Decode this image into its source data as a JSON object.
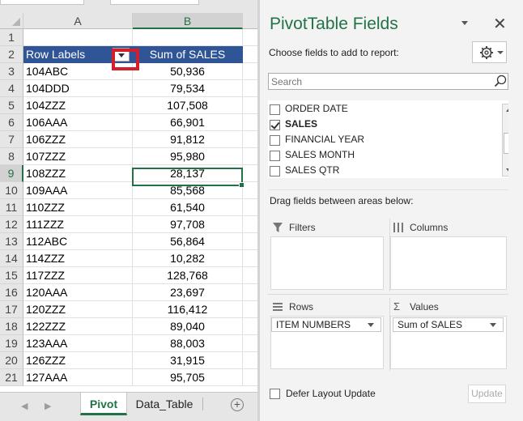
{
  "sheet": {
    "columns": [
      "A",
      "B"
    ],
    "rows": [
      {
        "num": "1",
        "a": "",
        "b": ""
      },
      {
        "num": "2",
        "a": "Row Labels",
        "b": "Sum of SALES"
      },
      {
        "num": "3",
        "a": "104ABC",
        "b": "50,936"
      },
      {
        "num": "4",
        "a": "104DDD",
        "b": "79,534"
      },
      {
        "num": "5",
        "a": "104ZZZ",
        "b": "107,508"
      },
      {
        "num": "6",
        "a": "106AAA",
        "b": "66,901"
      },
      {
        "num": "7",
        "a": "106ZZZ",
        "b": "91,812"
      },
      {
        "num": "8",
        "a": "107ZZZ",
        "b": "95,980"
      },
      {
        "num": "9",
        "a": "108ZZZ",
        "b": "28,137"
      },
      {
        "num": "10",
        "a": "109AAA",
        "b": "85,568"
      },
      {
        "num": "11",
        "a": "110ZZZ",
        "b": "61,540"
      },
      {
        "num": "12",
        "a": "111ZZZ",
        "b": "97,708"
      },
      {
        "num": "13",
        "a": "112ABC",
        "b": "56,864"
      },
      {
        "num": "14",
        "a": "114ZZZ",
        "b": "10,282"
      },
      {
        "num": "15",
        "a": "117ZZZ",
        "b": "128,768"
      },
      {
        "num": "16",
        "a": "120AAA",
        "b": "23,697"
      },
      {
        "num": "17",
        "a": "120ZZZ",
        "b": "116,412"
      },
      {
        "num": "18",
        "a": "122ZZZ",
        "b": "89,040"
      },
      {
        "num": "19",
        "a": "123AAA",
        "b": "88,003"
      },
      {
        "num": "20",
        "a": "126ZZZ",
        "b": "31,915"
      },
      {
        "num": "21",
        "a": "127AAA",
        "b": "95,705"
      }
    ],
    "tabs": {
      "active": "Pivot",
      "other": "Data_Table"
    },
    "colors": {
      "header_fill": "#2f5597",
      "accent": "#217346",
      "highlight": "#d21f2b"
    }
  },
  "pane": {
    "title": "PivotTable Fields",
    "close_glyph": "✕",
    "choose_label": "Choose fields to add to report:",
    "search_placeholder": "Search",
    "fields": [
      {
        "label": "ORDER DATE",
        "checked": false
      },
      {
        "label": "SALES",
        "checked": true
      },
      {
        "label": "FINANCIAL YEAR",
        "checked": false
      },
      {
        "label": "SALES MONTH",
        "checked": false
      },
      {
        "label": "SALES QTR",
        "checked": false
      }
    ],
    "drag_label": "Drag fields between areas below:",
    "areas": {
      "filters": "Filters",
      "columns": "Columns",
      "rows": "Rows",
      "values": "Values",
      "rows_item": "ITEM NUMBERS",
      "values_item": "Sum of SALES"
    },
    "defer_label": "Defer Layout Update",
    "update_label": "Update"
  }
}
